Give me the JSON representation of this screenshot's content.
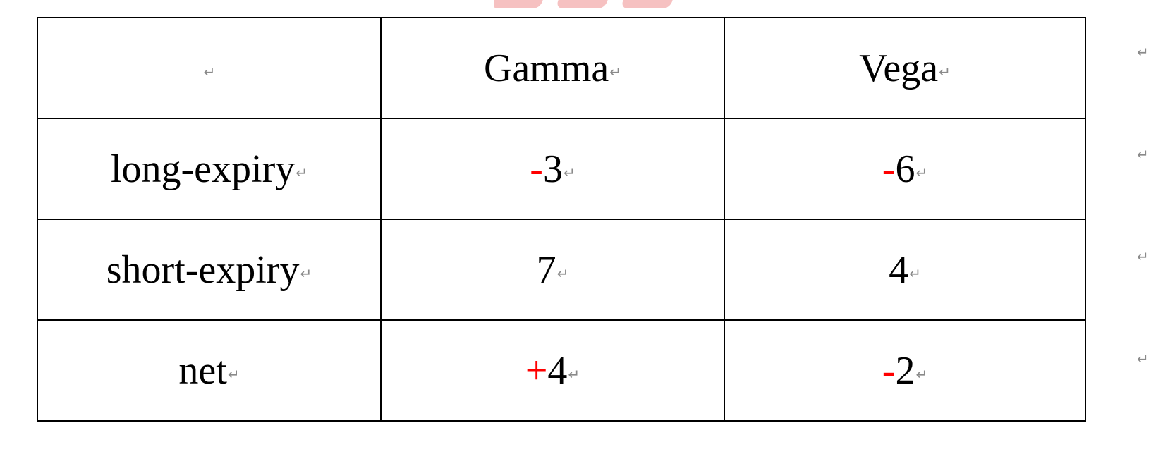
{
  "paragraph_mark": "↵",
  "colors": {
    "sign_highlight": "#ff0000",
    "border": "#000000",
    "formatting_mark": "#8a8a8a",
    "watermark": "#f4b6b6"
  },
  "table": {
    "header": {
      "corner": "",
      "columns": [
        "Gamma",
        "Vega"
      ]
    },
    "rows": [
      {
        "label": "long-expiry",
        "gamma": {
          "sign": "-",
          "value": "3"
        },
        "vega": {
          "sign": "-",
          "value": "6"
        }
      },
      {
        "label": "short-expiry",
        "gamma": {
          "sign": "",
          "value": "7"
        },
        "vega": {
          "sign": "",
          "value": "4"
        }
      },
      {
        "label": "net",
        "gamma": {
          "sign": "+",
          "value": "4"
        },
        "vega": {
          "sign": "-",
          "value": "2"
        }
      }
    ]
  }
}
